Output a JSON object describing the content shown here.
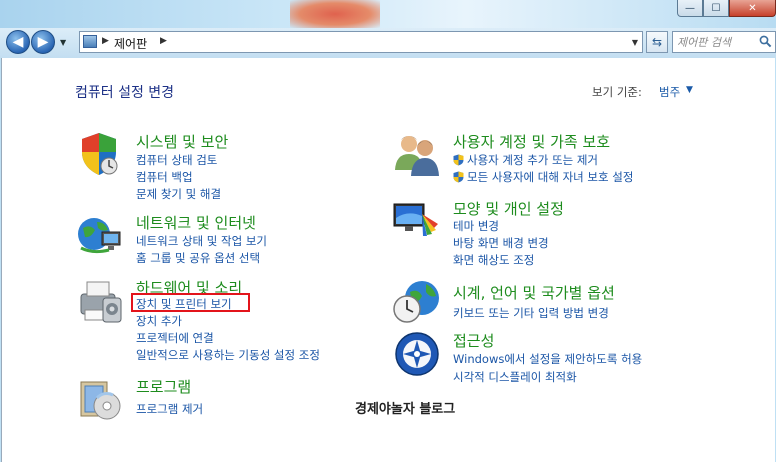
{
  "window": {
    "minimize_label": "—",
    "maximize_label": "☐",
    "close_label": "✕"
  },
  "nav": {
    "back_label": "◀",
    "forward_label": "▶",
    "breadcrumb": "제어판",
    "search_placeholder": "제어판 검색"
  },
  "content": {
    "heading": "컴퓨터 설정 변경",
    "view_by_label": "보기 기준:",
    "view_by_value": "범주"
  },
  "categories": {
    "system": {
      "title": "시스템 및 보안",
      "icon": "system-security-shield-icon",
      "links": [
        "컴퓨터 상태 검토",
        "컴퓨터 백업",
        "문제 찾기 및 해결"
      ]
    },
    "network": {
      "title": "네트워크 및 인터넷",
      "icon": "network-globe-icon",
      "links": [
        "네트워크 상태 및 작업 보기",
        "홈 그룹 및 공유 옵션 선택"
      ]
    },
    "hardware": {
      "title": "하드웨어 및 소리",
      "icon": "printer-hardware-icon",
      "links": [
        "장치 및 프린터 보기",
        "장치 추가",
        "프로젝터에 연결",
        "일반적으로 사용하는 기동성 설정 조정"
      ]
    },
    "programs": {
      "title": "프로그램",
      "icon": "programs-disc-icon",
      "links": [
        "프로그램 제거"
      ]
    },
    "users": {
      "title": "사용자 계정 및 가족 보호",
      "icon": "users-icon",
      "links": [
        "사용자 계정 추가 또는 제거",
        "모든 사용자에 대해 자녀 보호 설정"
      ]
    },
    "appearance": {
      "title": "모양 및 개인 설정",
      "icon": "appearance-monitor-icon",
      "links": [
        "테마 변경",
        "바탕 화면 배경 변경",
        "화면 해상도 조정"
      ]
    },
    "clock": {
      "title": "시계, 언어 및 국가별 옵션",
      "icon": "clock-globe-icon",
      "links": [
        "키보드 또는 기타 입력 방법 변경"
      ]
    },
    "access": {
      "title": "접근성",
      "icon": "accessibility-icon",
      "links": [
        "Windows에서 설정을 제안하도록 허용",
        "시각적 디스플레이 최적화"
      ]
    }
  },
  "watermark": "경제야놀자 블로그",
  "colors": {
    "category_title": "#1e8c1e",
    "link": "#1a55a6",
    "heading": "#1e3287",
    "highlight": "#e3141b"
  }
}
